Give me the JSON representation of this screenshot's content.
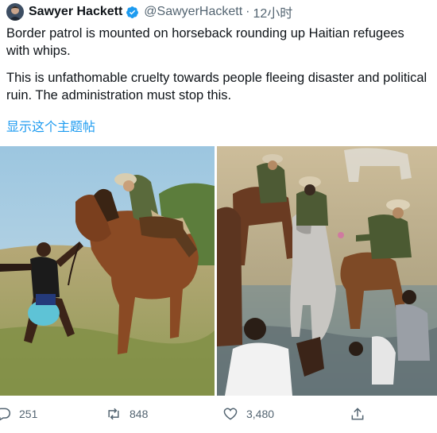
{
  "author": {
    "display_name": "Sawyer Hackett",
    "handle": "@SawyerHackett",
    "separator": "·",
    "time": "12小时",
    "verified": true
  },
  "tweet": {
    "paragraph_1": "Border patrol is mounted on horseback rounding up Haitian refugees with whips.",
    "paragraph_2": "This is unfathomable cruelty towards people fleeing disaster and political ruin. The administration must stop this.",
    "show_thread": "显示这个主题帖"
  },
  "actions": {
    "replies": "251",
    "retweets": "848",
    "likes": "3,480"
  },
  "colors": {
    "accent": "#1d9bf0",
    "muted": "#536471",
    "text": "#0f1419"
  },
  "icons": {
    "reply": "reply-icon",
    "retweet": "retweet-icon",
    "like": "heart-icon",
    "share": "share-icon",
    "verified": "verified-badge-icon"
  }
}
